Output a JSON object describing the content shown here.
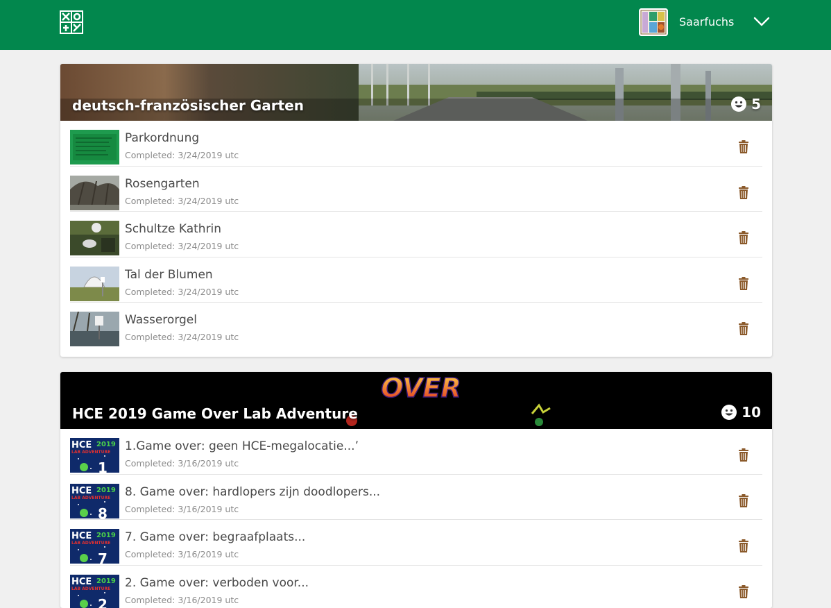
{
  "header": {
    "username": "Saarfuchs",
    "brand_color": "#02874d"
  },
  "cards": [
    {
      "title": "deutsch-französischer Garten",
      "count": "5",
      "items": [
        {
          "title": "Parkordnung",
          "completed": "Completed: 3/24/2019 utc"
        },
        {
          "title": "Rosengarten",
          "completed": "Completed: 3/24/2019 utc"
        },
        {
          "title": "Schultze Kathrin",
          "completed": "Completed: 3/24/2019 utc"
        },
        {
          "title": "Tal der Blumen",
          "completed": "Completed: 3/24/2019 utc"
        },
        {
          "title": "Wasserorgel",
          "completed": "Completed: 3/24/2019 utc"
        }
      ]
    },
    {
      "title": "HCE 2019 Game Over Lab Adventure",
      "count": "10",
      "banner_text": "OVER",
      "items": [
        {
          "title": "1.Game over: geen HCE-megalocatie...’",
          "completed": "Completed: 3/16/2019 utc",
          "thumb_number": "1"
        },
        {
          "title": "8. Game over: hardlopers zijn doodlopers...",
          "completed": "Completed: 3/16/2019 utc",
          "thumb_number": "8"
        },
        {
          "title": "7. Game over: begraafplaats...",
          "completed": "Completed: 3/16/2019 utc",
          "thumb_number": "7"
        },
        {
          "title": "2. Game over: verboden voor...",
          "completed": "Completed: 3/16/2019 utc",
          "thumb_number": "2"
        }
      ],
      "thumb_label_top": "HCE",
      "thumb_label_year": "2019",
      "thumb_label_sub": "LAB ADVENTURE"
    }
  ],
  "icons": {
    "logo": "geocaching-logo-icon",
    "menu": "chevron-down-icon",
    "count": "smiley-icon",
    "delete": "trash-icon"
  }
}
